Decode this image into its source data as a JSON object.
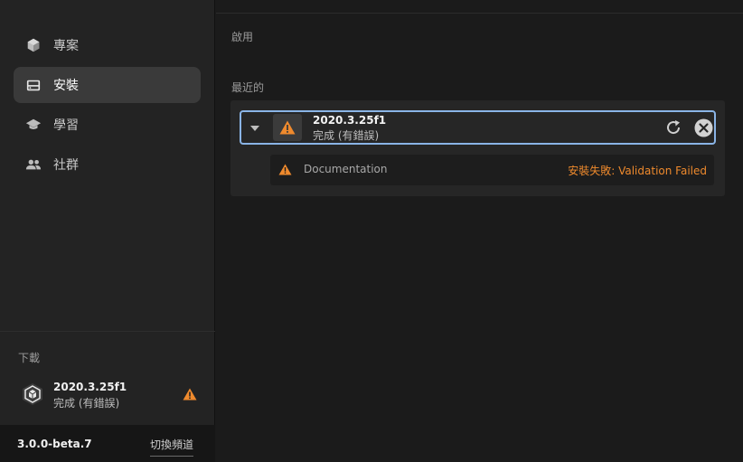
{
  "sidebar": {
    "nav": [
      {
        "label": "專案",
        "icon": "cube-icon",
        "active": false
      },
      {
        "label": "安裝",
        "icon": "drive-icon",
        "active": true
      },
      {
        "label": "學習",
        "icon": "graduation-cap-icon",
        "active": false
      },
      {
        "label": "社群",
        "icon": "people-icon",
        "active": false
      }
    ],
    "downloads": {
      "heading": "下載",
      "item": {
        "version": "2020.3.25f1",
        "status": "完成 (有錯誤)",
        "icon": "unity-logo-icon",
        "warning_icon": "warning-icon"
      }
    },
    "footer": {
      "app_version": "3.0.0-beta.7",
      "switch_channel_label": "切換頻道"
    }
  },
  "main": {
    "enabled_label": "啟用",
    "recent_label": "最近的",
    "install": {
      "version": "2020.3.25f1",
      "status": "完成 (有錯誤)",
      "expand_icon": "caret-down-icon",
      "status_icon": "warning-icon",
      "retry_icon": "refresh-icon",
      "cancel_icon": "close-circle-icon",
      "modules": [
        {
          "name": "Documentation",
          "error": "安裝失敗: Validation Failed",
          "icon": "warning-icon"
        }
      ]
    }
  },
  "colors": {
    "accent_blue": "#8ab4e6",
    "warning_orange": "#ef8a2d",
    "sidebar_bg": "#232323",
    "main_bg": "#1b1b1b",
    "panel_bg": "#262626",
    "active_nav_bg": "#3a3a3a"
  }
}
